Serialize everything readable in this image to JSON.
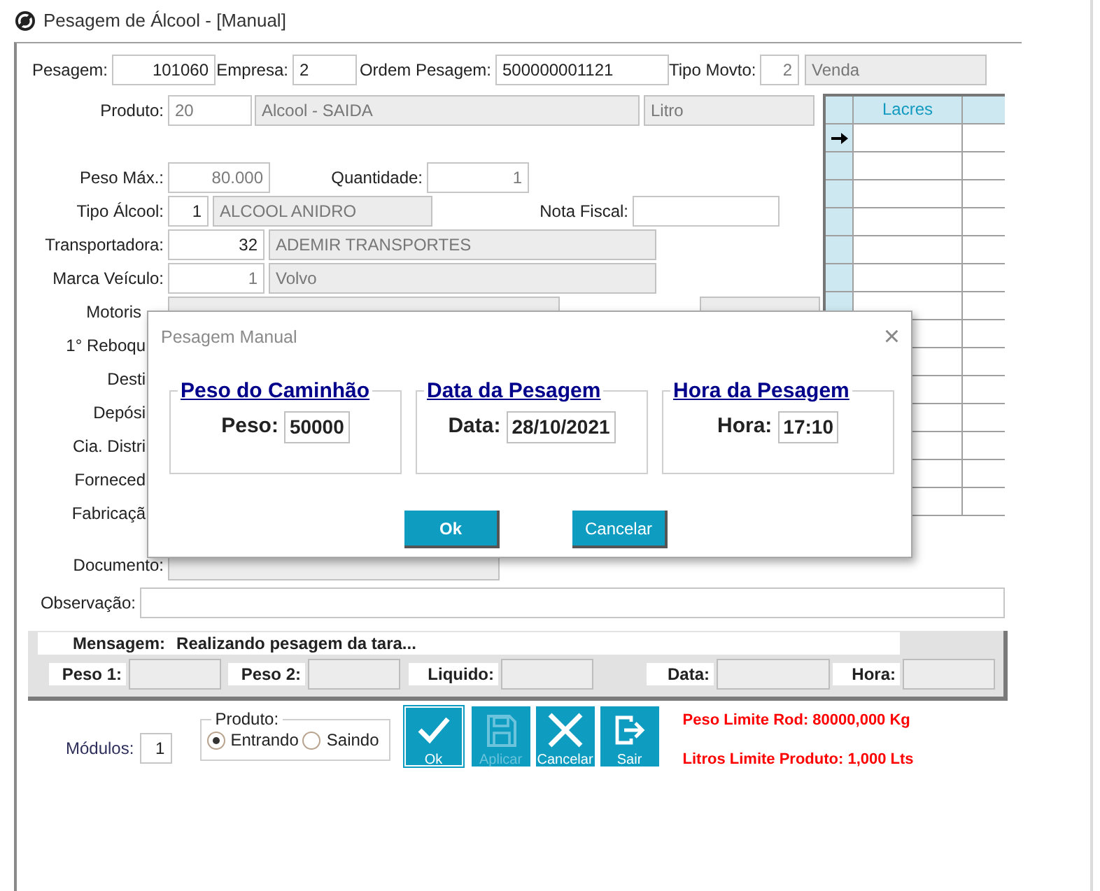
{
  "window": {
    "title": "Pesagem de Álcool - [Manual]"
  },
  "header_row": {
    "fields": [
      {
        "label": "Pesagem:",
        "value": "101060",
        "kind": "input"
      },
      {
        "label": "Empresa:",
        "value": "2",
        "kind": "input"
      },
      {
        "label": "Ordem Pesagem:",
        "value": "500000001121",
        "kind": "input"
      },
      {
        "label": "Tipo Movto:",
        "value": "2",
        "kind": "locked"
      },
      {
        "value": "Venda",
        "kind": "readonly"
      }
    ]
  },
  "left_rows": [
    {
      "fields": [
        {
          "label": "Produto:",
          "value": "20",
          "kind": "locked"
        },
        {
          "value": "Alcool - SAIDA",
          "kind": "readonly"
        },
        {
          "value": "Litro",
          "kind": "readonly"
        }
      ]
    },
    {
      "fields": [
        {
          "label": "Peso Máx.:",
          "value": "80.000",
          "kind": "locked"
        },
        {
          "label": "Quantidade:",
          "value": "1",
          "kind": "locked"
        }
      ]
    },
    {
      "fields": [
        {
          "label": "Tipo Álcool:",
          "value": "1",
          "kind": "input"
        },
        {
          "value": "ALCOOL ANIDRO",
          "kind": "readonly"
        },
        {
          "label": "Nota Fiscal:",
          "kind": "input"
        }
      ]
    },
    {
      "fields": [
        {
          "label": "Transportadora:",
          "value": "32",
          "kind": "input"
        },
        {
          "value": "ADEMIR TRANSPORTES",
          "kind": "readonly"
        }
      ]
    },
    {
      "fields": [
        {
          "label": "Marca Veículo:",
          "value": "1",
          "kind": "locked"
        },
        {
          "value": "Volvo",
          "kind": "readonly"
        }
      ]
    },
    {
      "fields": [
        {
          "label": "Motoris",
          "kind": "readonly"
        },
        {
          "kind": "readonly"
        }
      ]
    },
    {
      "fields": [
        {
          "label": "1° Reboqu"
        }
      ]
    },
    {
      "fields": [
        {
          "label": "Desti"
        }
      ]
    },
    {
      "fields": [
        {
          "label": "Depósi"
        }
      ]
    },
    {
      "fields": [
        {
          "label": "Cia. Distri"
        }
      ]
    },
    {
      "fields": [
        {
          "label": "Forneced"
        }
      ]
    },
    {
      "fields": [
        {
          "label": "Fabricaçã"
        }
      ]
    }
  ],
  "lacres_grid": {
    "columns": [
      "Lacres"
    ],
    "rows": [
      {
        "selected": true
      },
      {
        "selected": false
      },
      {
        "selected": false
      },
      {
        "selected": false
      },
      {
        "selected": false
      },
      {
        "selected": false
      },
      {
        "selected": false
      }
    ]
  },
  "bottom_rows": [
    {
      "fields": [
        {
          "label": "Documento:",
          "kind": "readonly"
        }
      ]
    },
    {
      "fields": [
        {
          "label": "Observação:",
          "kind": "input"
        }
      ]
    }
  ],
  "message_panel": {
    "label": "Mensagem:",
    "text": "Realizando pesagem da tara...",
    "fields": [
      {
        "label": "Peso 1:"
      },
      {
        "label": "Peso 2:"
      },
      {
        "label": "Liquido:"
      },
      {
        "label": "Data:"
      },
      {
        "label": "Hora:"
      }
    ]
  },
  "modulos": {
    "label": "Módulos:",
    "value": "1"
  },
  "produto_group": {
    "legend": "Produto:",
    "options": [
      {
        "label": "Entrando",
        "selected": true
      },
      {
        "label": "Saindo",
        "selected": false
      }
    ]
  },
  "toolbar": [
    {
      "kind": "ok",
      "label": "Ok",
      "focused": true,
      "disabled": false
    },
    {
      "kind": "save",
      "label": "Aplicar",
      "focused": false,
      "disabled": true
    },
    {
      "kind": "cancel",
      "label": "Cancelar",
      "focused": false,
      "disabled": false
    },
    {
      "kind": "exit",
      "label": "Sair",
      "focused": false,
      "disabled": false
    }
  ],
  "limits": [
    "Peso Limite Rod: 80000,000 Kg",
    "Litros Limite Produto: 1,000 Lts"
  ],
  "dialog": {
    "title": "Pesagem Manual",
    "close": "×",
    "groups": [
      {
        "legend": "Peso do Caminhão",
        "label": "Peso:",
        "value": "50000"
      },
      {
        "legend": "Data da Pesagem",
        "label": "Data:",
        "value": "28/10/2021"
      },
      {
        "legend": "Hora da Pesagem",
        "label": "Hora:",
        "value": "17:10"
      }
    ],
    "buttons": [
      "Ok",
      "Cancelar"
    ]
  }
}
